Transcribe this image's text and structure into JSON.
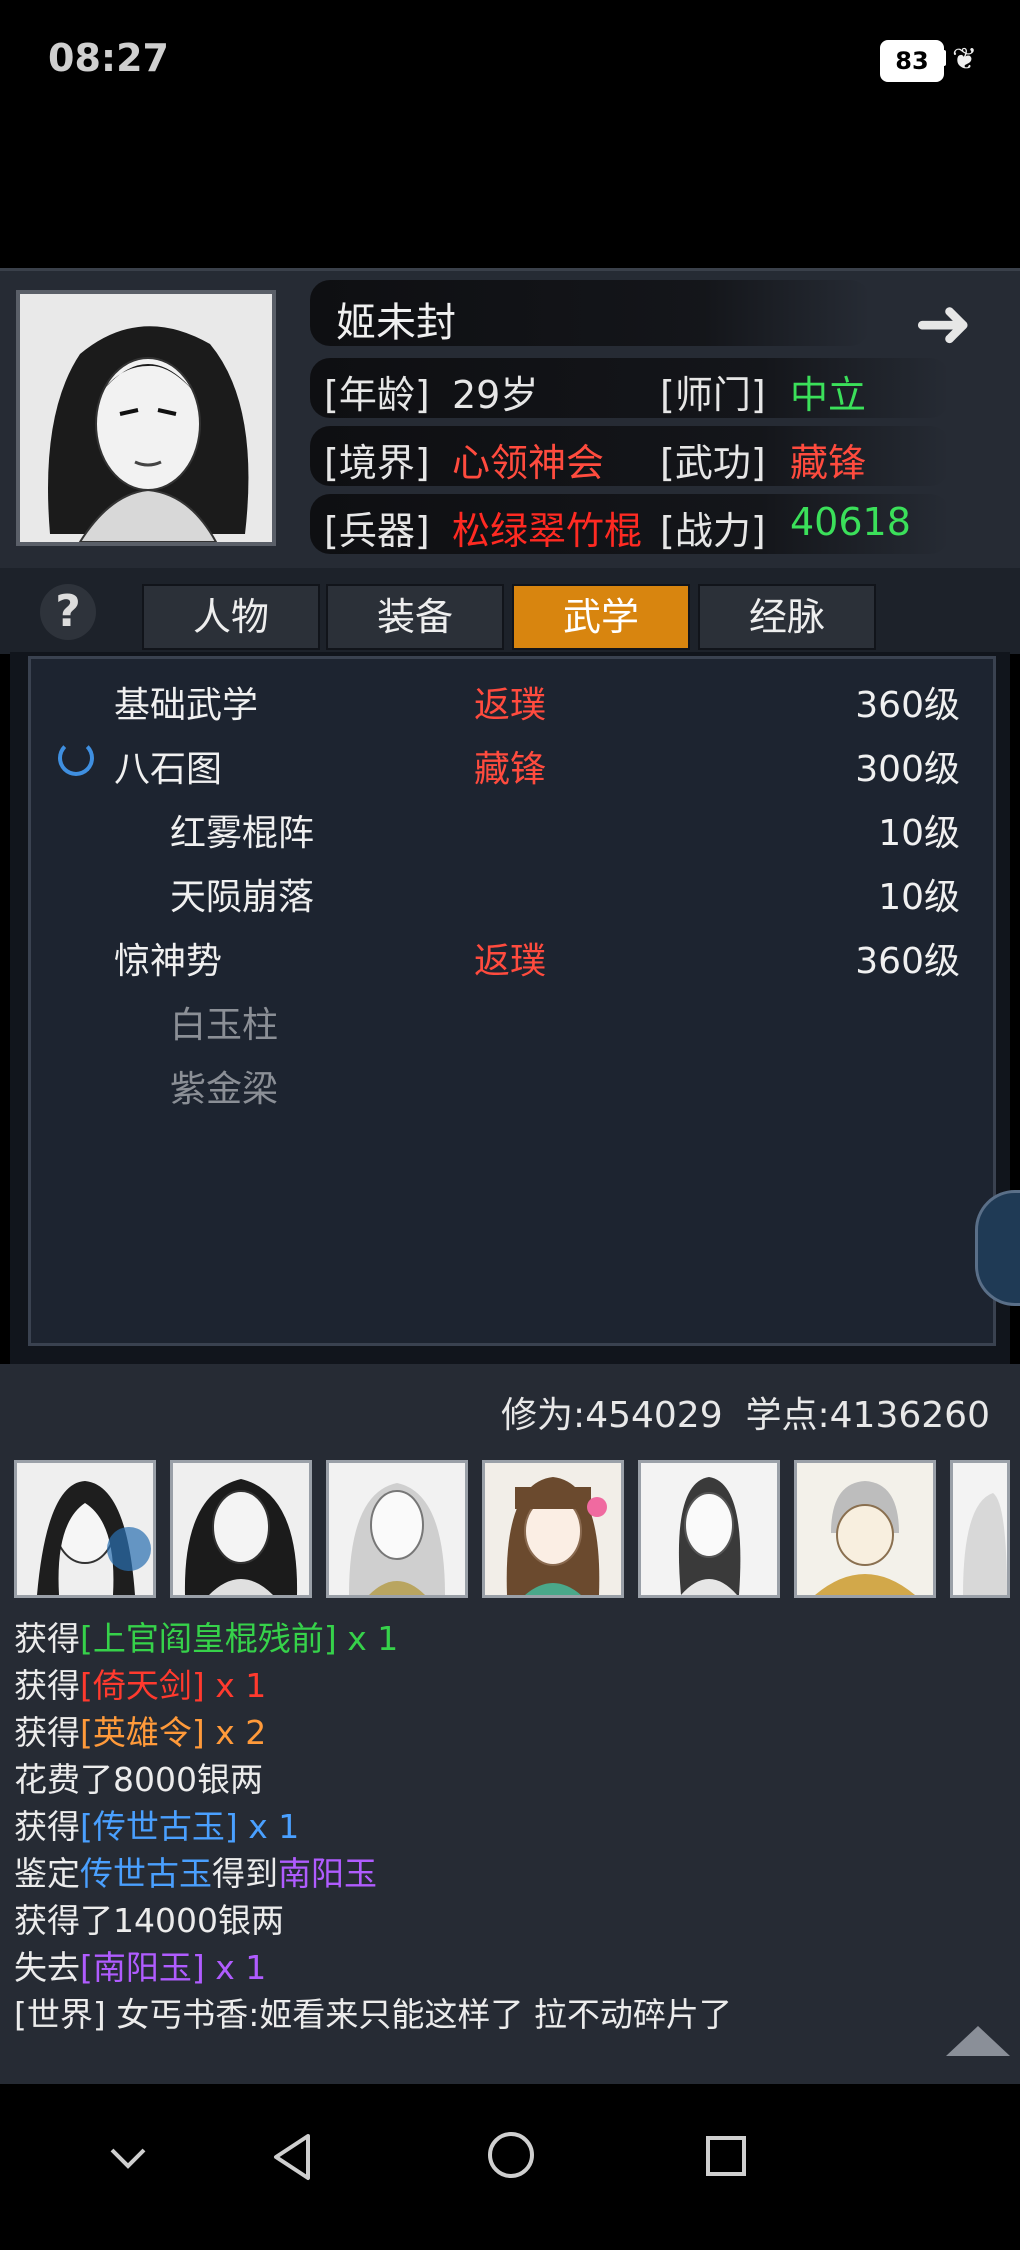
{
  "status_bar": {
    "time": "08:27",
    "battery": "83"
  },
  "hero": {
    "name": "姬未封",
    "rows": [
      [
        {
          "label": "[年龄]",
          "value": "29岁",
          "color": "#e6e6e6"
        },
        {
          "label": "[师门]",
          "value": "中立",
          "color": "#3be05a"
        }
      ],
      [
        {
          "label": "[境界]",
          "value": "心领神会",
          "color": "#ff4b3e"
        },
        {
          "label": "[武功]",
          "value": "藏锋",
          "color": "#ff4b3e"
        }
      ],
      [
        {
          "label": "[兵器]",
          "value": "松绿翠竹棍",
          "color": "#ff2a22"
        },
        {
          "label": "[战力]",
          "value": "40618",
          "color": "#3be05a"
        }
      ]
    ]
  },
  "tabs": [
    "人物",
    "装备",
    "武学",
    "经脉"
  ],
  "active_tab": "武学",
  "martial_arts": [
    {
      "name": "基础武学",
      "rank": "返璞",
      "level": "360级",
      "indent": 0,
      "muted": false
    },
    {
      "name": "八石图",
      "rank": "藏锋",
      "level": "300级",
      "indent": 0,
      "muted": false
    },
    {
      "name": "红雾棍阵",
      "rank": "",
      "level": "10级",
      "indent": 1,
      "muted": false
    },
    {
      "name": "天陨崩落",
      "rank": "",
      "level": "10级",
      "indent": 1,
      "muted": false
    },
    {
      "name": "惊神势",
      "rank": "返璞",
      "level": "360级",
      "indent": 0,
      "muted": false
    },
    {
      "name": "白玉柱",
      "rank": "",
      "level": "",
      "indent": 1,
      "muted": true
    },
    {
      "name": "紫金梁",
      "rank": "",
      "level": "",
      "indent": 1,
      "muted": true
    }
  ],
  "stats": {
    "cultivation_label": "修为:",
    "cultivation": "454029",
    "points_label": "学点:",
    "points": "4136260"
  },
  "roster_count": 7,
  "log": [
    [
      {
        "t": "获得",
        "c": ""
      },
      {
        "t": "[上官阎皇棍残前]",
        "c": "c-green"
      },
      {
        "t": " x 1",
        "c": "c-green"
      }
    ],
    [
      {
        "t": "获得",
        "c": ""
      },
      {
        "t": "[倚天剑]",
        "c": "c-red"
      },
      {
        "t": " x 1",
        "c": "c-red"
      }
    ],
    [
      {
        "t": "获得",
        "c": ""
      },
      {
        "t": "[英雄令]",
        "c": "c-orange"
      },
      {
        "t": " x 2",
        "c": "c-orange"
      }
    ],
    [
      {
        "t": "花费了8000银两",
        "c": ""
      }
    ],
    [
      {
        "t": "获得",
        "c": ""
      },
      {
        "t": "[传世古玉]",
        "c": "c-blue"
      },
      {
        "t": " x 1",
        "c": "c-blue"
      }
    ],
    [
      {
        "t": "鉴定",
        "c": ""
      },
      {
        "t": "传世古玉",
        "c": "c-blue"
      },
      {
        "t": "得到",
        "c": ""
      },
      {
        "t": "南阳玉",
        "c": "c-purple"
      }
    ],
    [
      {
        "t": "获得了14000银两",
        "c": ""
      }
    ],
    [
      {
        "t": "失去",
        "c": ""
      },
      {
        "t": "[南阳玉]",
        "c": "c-purple"
      },
      {
        "t": " x 1",
        "c": "c-purple"
      }
    ],
    [
      {
        "t": "[世界] 女丐书香:姬看来只能这样了 拉不动碎片了",
        "c": ""
      }
    ]
  ]
}
